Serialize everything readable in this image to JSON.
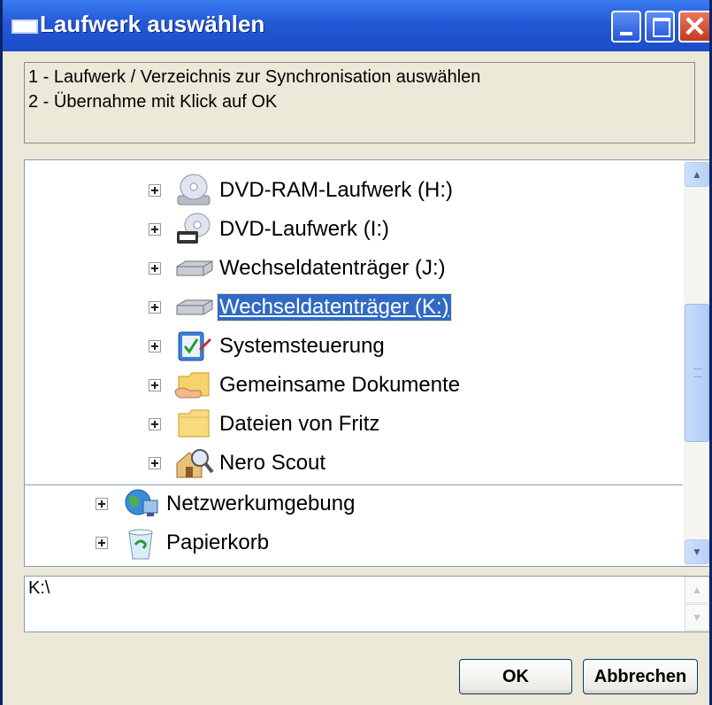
{
  "window": {
    "title": "Laufwerk auswählen",
    "controls": [
      "minimize-icon",
      "maximize-icon",
      "close-icon"
    ]
  },
  "instructions": {
    "line1": "1 - Laufwerk / Verzeichnis zur Synchronisation auswählen",
    "line2": "2 - Übernahme mit Klick auf OK"
  },
  "tree": {
    "items": [
      {
        "label": "DVD-RAM-Laufwerk (H:)",
        "icon": "dvd-ram-drive-icon"
      },
      {
        "label": "DVD-Laufwerk (I:)",
        "icon": "dvd-drive-icon"
      },
      {
        "label": "Wechseldatenträger (J:)",
        "icon": "removable-drive-icon"
      },
      {
        "label": "Wechseldatenträger (K:)",
        "icon": "removable-drive-icon",
        "selected": true
      },
      {
        "label": "Systemsteuerung",
        "icon": "control-panel-icon"
      },
      {
        "label": "Gemeinsame Dokumente",
        "icon": "shared-folder-icon"
      },
      {
        "label": "Dateien von Fritz",
        "icon": "folder-icon"
      },
      {
        "label": "Nero Scout",
        "icon": "nero-scout-icon"
      },
      {
        "label": "Netzwerkumgebung",
        "icon": "network-icon"
      },
      {
        "label": "Papierkorb",
        "icon": "recycle-bin-icon"
      }
    ]
  },
  "path": {
    "value": "K:\\"
  },
  "buttons": {
    "ok": "OK",
    "cancel": "Abbrechen"
  },
  "colors": {
    "titlebar": "#2458D6",
    "selection": "#316AC5",
    "dialog_bg": "#ECE9D8"
  }
}
